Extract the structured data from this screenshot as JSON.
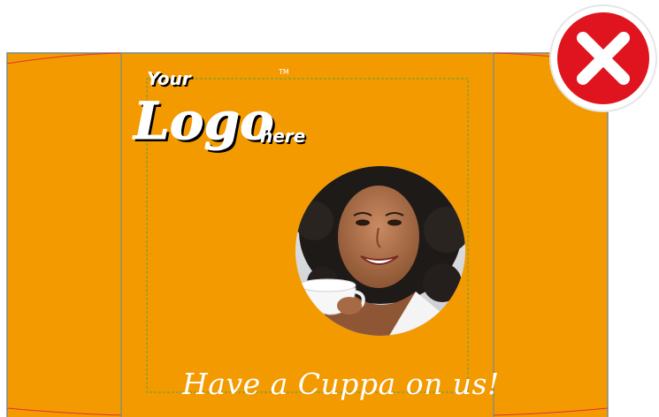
{
  "design": {
    "logo": {
      "word_top": "Your",
      "word_main": "Logo",
      "word_bottom": "here",
      "trademark": "TM"
    },
    "tagline": "Have a Cuppa on us!",
    "photo_icon": "woman-with-cup-photo",
    "status_icon": "reject-x-icon"
  },
  "colors": {
    "background": "#f39a00",
    "guide_blue": "#5b8aa6",
    "guide_green": "#5aa03c",
    "bleed_red": "#e0303a",
    "reject_red": "#e0141e"
  }
}
